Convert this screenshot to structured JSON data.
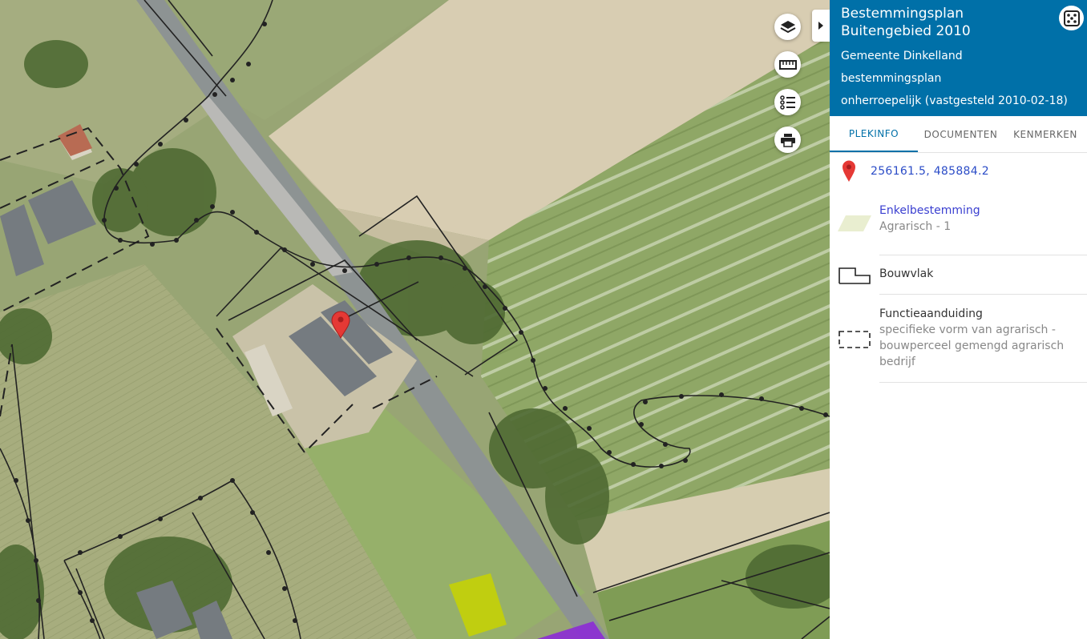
{
  "map": {
    "controls": {
      "layers_icon": "layers-icon",
      "measure_icon": "ruler-icon",
      "legend_icon": "list-icon",
      "print_icon": "printer-icon",
      "collapse_icon": "caret-right-icon"
    },
    "marker_color": "#e53935",
    "colors": {
      "yellow_parcel": "#c8d400",
      "purple_parcel": "#8c2bd6",
      "plan_line": "#222222"
    }
  },
  "panel": {
    "title": "Bestemmingsplan Buitengebied 2010",
    "municipality": "Gemeente Dinkelland",
    "plan_type": "bestemmingsplan",
    "status": "onherroepelijk (vastgesteld 2010-02-18)",
    "header_color": "#0070a8",
    "fullscreen_icon": "dice-five-icon",
    "tabs": [
      {
        "label": "PLEKINFO",
        "active": true
      },
      {
        "label": "DOCUMENTEN",
        "active": false
      },
      {
        "label": "KENMERKEN",
        "active": false
      }
    ],
    "coordinates": "256161.5, 485884.2",
    "pin_icon": "map-pin-icon",
    "legend": [
      {
        "title": "Enkelbestemming",
        "sub": "Agrarisch - 1",
        "symbol": "agrarisch-swatch-icon",
        "color": "#e9eed0"
      },
      {
        "title": "Bouwvlak",
        "sub": "",
        "symbol": "bouwvlak-outline-icon"
      },
      {
        "title": "Functieaanduiding",
        "sub": "specifieke vorm van agrarisch - bouwperceel gemengd agrarisch bedrijf",
        "symbol": "dashed-rectangle-icon"
      }
    ]
  }
}
